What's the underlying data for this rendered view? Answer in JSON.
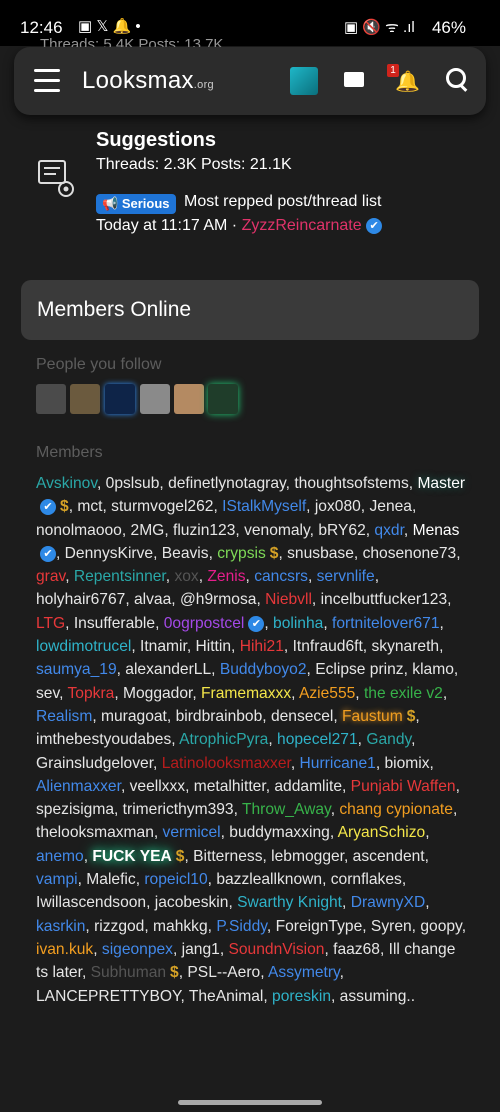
{
  "status": {
    "time": "12:46",
    "battery": "46%"
  },
  "behind_text": "Threads: 5.4K Posts: 13.7K",
  "nav": {
    "logo": "Looksmax",
    "logo_suffix": ".org",
    "alerts_badge": "1"
  },
  "forum": {
    "title": "Suggestions",
    "stats": "Threads: 2.3K Posts: 21.1K",
    "prefix": "Serious",
    "latest_title": "Most repped post/thread list",
    "latest_time": "Today at 11:17 AM ·",
    "latest_user": "ZyzzReincarnate"
  },
  "members_online": {
    "title": "Members Online",
    "people_you_follow": "People you follow",
    "members_label": "Members"
  },
  "members": [
    {
      "name": "Avskinov",
      "color": "teal"
    },
    {
      "name": "0pslsub",
      "color": "default"
    },
    {
      "name": "definetlynotagray",
      "color": "default"
    },
    {
      "name": "thoughtsofstems",
      "color": "default"
    },
    {
      "name": "Master",
      "color": "glowdark",
      "badge": "✔",
      "dollar": true
    },
    {
      "name": "mct",
      "color": "default"
    },
    {
      "name": "sturmvogel262",
      "color": "default"
    },
    {
      "name": "IStalkMyself",
      "color": "blue"
    },
    {
      "name": "jox080",
      "color": "strike"
    },
    {
      "name": "Jenea",
      "color": "default"
    },
    {
      "name": "nonolmaooo",
      "color": "default"
    },
    {
      "name": "2MG",
      "color": "default"
    },
    {
      "name": "fluzin123",
      "color": "default"
    },
    {
      "name": "venomaly",
      "color": "default"
    },
    {
      "name": "bRY62",
      "color": "default"
    },
    {
      "name": "qxdr",
      "color": "blue"
    },
    {
      "name": "Menas",
      "color": "white",
      "badge": "✔"
    },
    {
      "name": "DennysKirve",
      "color": "default"
    },
    {
      "name": "Beavis",
      "color": "default"
    },
    {
      "name": "crypsis",
      "color": "lime",
      "dollar": true
    },
    {
      "name": "snusbase",
      "color": "default"
    },
    {
      "name": "chosenone73",
      "color": "default"
    },
    {
      "name": "grav",
      "color": "red"
    },
    {
      "name": "Repentsinner",
      "color": "teal"
    },
    {
      "name": "xox",
      "color": "gray"
    },
    {
      "name": "Zenis",
      "color": "pink"
    },
    {
      "name": "cancsrs",
      "color": "blue"
    },
    {
      "name": "servnlife",
      "color": "blue"
    },
    {
      "name": "holyhair6767",
      "color": "default"
    },
    {
      "name": "alvaa",
      "color": "default"
    },
    {
      "name": "@h9rmosa",
      "color": "default"
    },
    {
      "name": "Niebvll",
      "color": "red"
    },
    {
      "name": "incelbuttfucker123",
      "color": "default"
    },
    {
      "name": "LTG",
      "color": "red"
    },
    {
      "name": "Insufferable",
      "color": "default"
    },
    {
      "name": "0ogrpostcel",
      "color": "purple",
      "badge": "✔"
    },
    {
      "name": "bolinha",
      "color": "cyan"
    },
    {
      "name": "fortnitelover671",
      "color": "blue"
    },
    {
      "name": "lowdimotrucel",
      "color": "cyan"
    },
    {
      "name": "Itnamir",
      "color": "default"
    },
    {
      "name": "Hittin",
      "color": "default"
    },
    {
      "name": "Hihi21",
      "color": "red"
    },
    {
      "name": "Itnfraud6ft",
      "color": "default"
    },
    {
      "name": "skynareth",
      "color": "default"
    },
    {
      "name": "saumya_19",
      "color": "blue"
    },
    {
      "name": "alexanderLL",
      "color": "default"
    },
    {
      "name": "Buddyboyo2",
      "color": "blue"
    },
    {
      "name": "Eclipse prinz",
      "color": "default"
    },
    {
      "name": "klamo",
      "color": "default"
    },
    {
      "name": "sev",
      "color": "default"
    },
    {
      "name": "Topkra",
      "color": "red"
    },
    {
      "name": "Moggador",
      "color": "default"
    },
    {
      "name": "Framemaxxx",
      "color": "yellow"
    },
    {
      "name": "Azie555",
      "color": "orange"
    },
    {
      "name": "the exile v2",
      "color": "green"
    },
    {
      "name": "Realism",
      "color": "blue"
    },
    {
      "name": "muragoat",
      "color": "default"
    },
    {
      "name": "birdbrainbob",
      "color": "default"
    },
    {
      "name": "densecel",
      "color": "default"
    },
    {
      "name": "Faustum",
      "color": "orangeglow",
      "dollar": true
    },
    {
      "name": "imthebestyoudabes",
      "color": "default"
    },
    {
      "name": "AtrophicPyra",
      "color": "teal"
    },
    {
      "name": "hopecel271",
      "color": "cyan"
    },
    {
      "name": "Gandy",
      "color": "teal"
    },
    {
      "name": "Grainsludgelover",
      "color": "default"
    },
    {
      "name": "Latinolooksmaxxer",
      "color": "darkred"
    },
    {
      "name": "Hurricane1",
      "color": "blue"
    },
    {
      "name": "biomix",
      "color": "default"
    },
    {
      "name": "Alienmaxxer",
      "color": "blue"
    },
    {
      "name": "veellxxx",
      "color": "default"
    },
    {
      "name": "metalhitter",
      "color": "default"
    },
    {
      "name": "addamlite",
      "color": "default"
    },
    {
      "name": "Punjabi Waffen",
      "color": "red"
    },
    {
      "name": "spezisigma",
      "color": "default"
    },
    {
      "name": "trimericthym393",
      "color": "default"
    },
    {
      "name": "Throw_Away",
      "color": "green"
    },
    {
      "name": "chang cypionate",
      "color": "orange"
    },
    {
      "name": "thelooksmaxman",
      "color": "default"
    },
    {
      "name": "vermicel",
      "color": "blue"
    },
    {
      "name": "buddymaxxing",
      "color": "default"
    },
    {
      "name": "AryanSchizo",
      "color": "yellow"
    },
    {
      "name": "anemo",
      "color": "blue"
    },
    {
      "name": "FUCK YEA",
      "color": "glow",
      "dollar": true
    },
    {
      "name": "Bitterness",
      "color": "default"
    },
    {
      "name": "lebmogger",
      "color": "default"
    },
    {
      "name": "ascendent",
      "color": "default"
    },
    {
      "name": "vampi",
      "color": "blue"
    },
    {
      "name": "Malefic",
      "color": "default"
    },
    {
      "name": "ropeicl10",
      "color": "blue"
    },
    {
      "name": "bazzleallknown",
      "color": "default"
    },
    {
      "name": "cornflakes",
      "color": "default"
    },
    {
      "name": "Iwillascendsoon",
      "color": "default"
    },
    {
      "name": "jacobeskin",
      "color": "default"
    },
    {
      "name": "Swarthy Knight",
      "color": "cyan"
    },
    {
      "name": "DrawnyXD",
      "color": "blue"
    },
    {
      "name": "kasrkin",
      "color": "blue"
    },
    {
      "name": "rizzgod",
      "color": "default"
    },
    {
      "name": "mahkkg",
      "color": "default"
    },
    {
      "name": "P.Siddy",
      "color": "blue"
    },
    {
      "name": "ForeignType",
      "color": "default"
    },
    {
      "name": "Syren",
      "color": "default"
    },
    {
      "name": "goopy",
      "color": "default"
    },
    {
      "name": "ivan.kuk",
      "color": "orange"
    },
    {
      "name": "sigeonpex",
      "color": "blue"
    },
    {
      "name": "jang1",
      "color": "default"
    },
    {
      "name": "SoundnVision",
      "color": "red"
    },
    {
      "name": "faaz68",
      "color": "default"
    },
    {
      "name": "Ill change ts later",
      "color": "default"
    },
    {
      "name": "Subhuman",
      "color": "gray",
      "dollar": true
    },
    {
      "name": "PSL--Aero",
      "color": "default"
    },
    {
      "name": "Assymetry",
      "color": "blue"
    },
    {
      "name": "LANCEPRETTYBOY",
      "color": "default"
    },
    {
      "name": "TheAnimal",
      "color": "default"
    },
    {
      "name": "poreskin",
      "color": "cyan"
    },
    {
      "name": "assuming..",
      "color": "default"
    }
  ]
}
